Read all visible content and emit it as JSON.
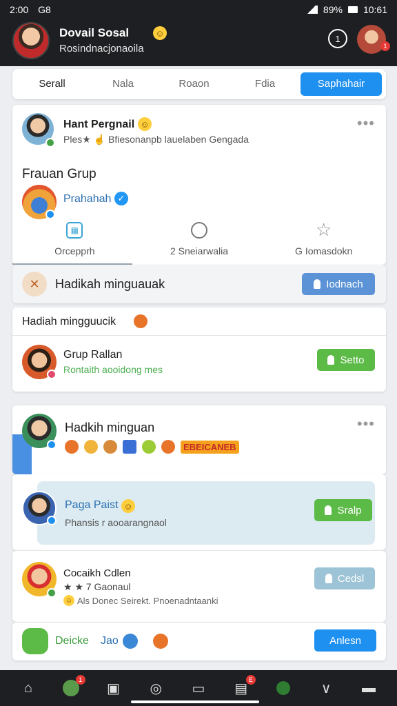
{
  "status_bar": {
    "time": "2:00",
    "carrier": "G8",
    "battery_text": "89%",
    "right_text": "10:61"
  },
  "header": {
    "title": "Dovail Sosal",
    "subtitle": "Rosindnacjonaoila",
    "badge_count": "1"
  },
  "tabs": [
    {
      "label": "Serall"
    },
    {
      "label": "Nala"
    },
    {
      "label": "Roaon"
    },
    {
      "label": "Fdia"
    },
    {
      "label": "Saphahair"
    }
  ],
  "post1": {
    "name": "Hant Pergnail",
    "desc": "Ples★ ☝ Bfiesonanpb lauelaben Gengada",
    "group_title": "Frauan Grup",
    "page_name": "Prahahah",
    "actions": [
      {
        "label": "Orcepprh",
        "icon": "image-icon"
      },
      {
        "label": "2 Sneiarwalia",
        "icon": "refresh-icon"
      },
      {
        "label": "G Iomasdokn",
        "icon": "star-icon"
      }
    ]
  },
  "group_banner": {
    "label": "Hadikah minguauak",
    "button": "Iodnach"
  },
  "section": {
    "title": "Hadiah mingguucik"
  },
  "suggest1": {
    "name": "Grup Rallan",
    "sub": "Rontaith aooidong mes",
    "button": "Setto"
  },
  "post2": {
    "name": "Hadkih minguan",
    "tag": "EBEICANEB"
  },
  "suggest2": {
    "name": "Paga Paist",
    "sub": "Phansis r aooarangnaol",
    "button": "Sralp"
  },
  "suggest3": {
    "name": "Cocaikh Cdlen",
    "line2": "★ ★ 7 Gaonaul",
    "line3": "Als Donec Seirekt. Pnoenadntaanki",
    "button": "Cedsl"
  },
  "bottom_row": {
    "text": "Deicke",
    "text2": "Jao",
    "button": "Anlesn"
  },
  "nav": [
    {
      "icon": "home-icon"
    },
    {
      "icon": "map-icon",
      "badge": "1"
    },
    {
      "icon": "camera-icon"
    },
    {
      "icon": "globe-icon"
    },
    {
      "icon": "tv-icon"
    },
    {
      "icon": "inbox-icon",
      "badge": "E"
    },
    {
      "icon": "leaf-icon"
    },
    {
      "icon": "chevron-icon"
    },
    {
      "icon": "tray-icon"
    }
  ],
  "colors": {
    "primary": "#1e90ef",
    "green": "#5cba47",
    "muted_blue": "#9dc4d6",
    "dark": "#1e1f22"
  }
}
